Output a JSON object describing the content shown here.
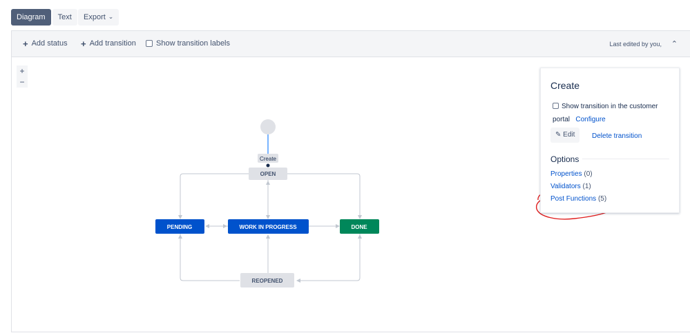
{
  "view_tabs": {
    "diagram": "Diagram",
    "text": "Text"
  },
  "export": {
    "label": "Export",
    "chevron": "chevron-down-icon"
  },
  "toolbar": {
    "add_status": "Add status",
    "add_transition": "Add transition",
    "show_labels": "Show transition labels",
    "last_edited": "Last edited by you,"
  },
  "zoom": {
    "in": "+",
    "out": "−"
  },
  "diagram": {
    "transition_label": "Create",
    "statuses": {
      "open": "OPEN",
      "pending": "PENDING",
      "in_progress": "WORK IN PROGRESS",
      "done": "DONE",
      "reopened": "REOPENED"
    },
    "colors": {
      "blue": "#0052cc",
      "green": "#00875a",
      "grey": "#dfe1e6",
      "line": "#c1c7d0",
      "annotation": "#e01e1e"
    }
  },
  "panel": {
    "title": "Create",
    "show_in_portal": "Show transition in the customer portal",
    "configure": "Configure",
    "edit": "Edit",
    "delete": "Delete transition",
    "options_title": "Options",
    "options": [
      {
        "label": "Properties",
        "count": "(0)"
      },
      {
        "label": "Validators",
        "count": "(1)"
      },
      {
        "label": "Post Functions",
        "count": "(5)"
      }
    ]
  }
}
